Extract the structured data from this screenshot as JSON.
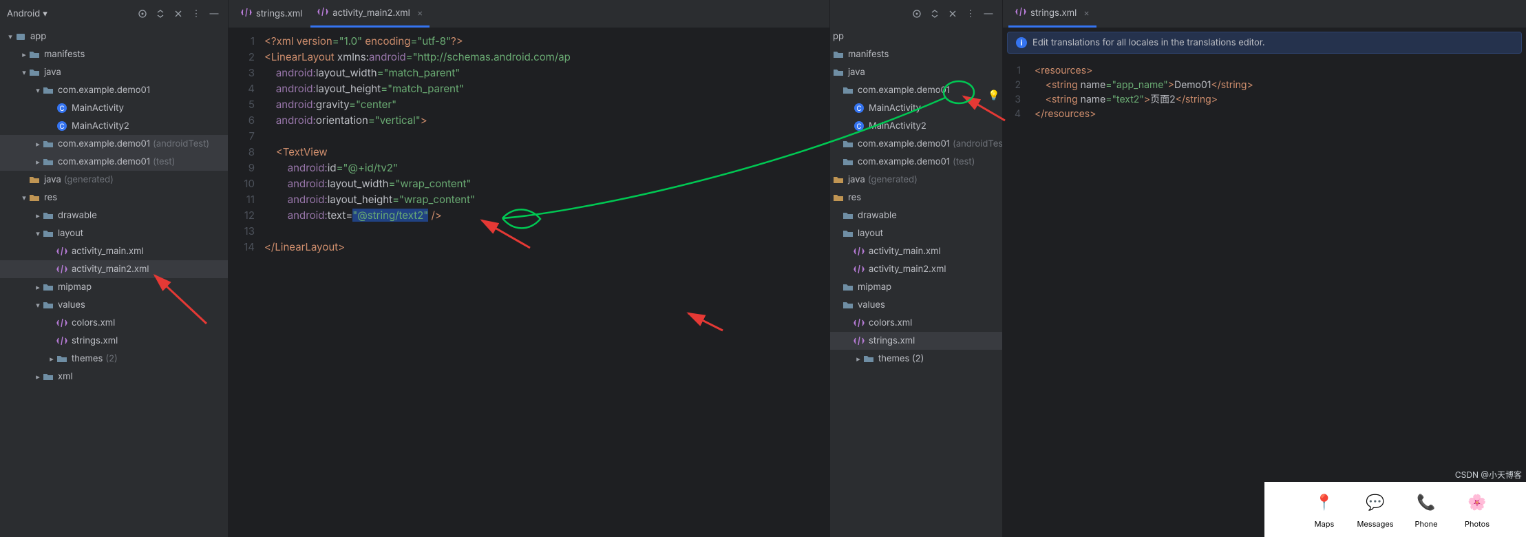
{
  "leftHeader": {
    "label": "Android"
  },
  "leftTree": {
    "app": "app",
    "manifests": "manifests",
    "java": "java",
    "pkg": "com.example.demo01",
    "mainActivity": "MainActivity",
    "mainActivity2": "MainActivity2",
    "pkgTest": "com.example.demo01",
    "pkgTestSuffix": "(androidTest)",
    "pkgUnit": "com.example.demo01",
    "pkgUnitSuffix": "(test)",
    "javaGen": "java",
    "javaGenSuffix": "(generated)",
    "res": "res",
    "drawable": "drawable",
    "layout": "layout",
    "layoutMain": "activity_main.xml",
    "layoutMain2": "activity_main2.xml",
    "mipmap": "mipmap",
    "values": "values",
    "colors": "colors.xml",
    "strings": "strings.xml",
    "themes": "themes",
    "themesSuffix": "(2)",
    "xmlFolder": "xml"
  },
  "midTabs": {
    "tab1": "strings.xml",
    "tab2": "activity_main2.xml"
  },
  "code1": {
    "l1a": "<?",
    "l1b": "xml version",
    "l1c": "=\"1.0\"",
    "l1d": " encoding",
    "l1e": "=\"utf-8\"",
    "l1f": "?>",
    "l2a": "<LinearLayout ",
    "l2b": "xmlns:",
    "l2c": "android",
    "l2d": "=\"http://schemas.android.com/ap",
    "l3a": "    ",
    "l3ns": "android:",
    "l3b": "layout_width",
    "l3c": "=\"match_parent\"",
    "l4a": "    ",
    "l4ns": "android:",
    "l4b": "layout_height",
    "l4c": "=\"match_parent\"",
    "l5a": "    ",
    "l5ns": "android:",
    "l5b": "gravity",
    "l5c": "=\"center\"",
    "l6a": "    ",
    "l6ns": "android:",
    "l6b": "orientation",
    "l6c": "=\"vertical\"",
    "l6d": ">",
    "l8a": "    <TextView",
    "l9a": "        ",
    "l9ns": "android:",
    "l9b": "id",
    "l9c": "=\"@+id/tv2\"",
    "l10a": "        ",
    "l10ns": "android:",
    "l10b": "layout_width",
    "l10c": "=\"wrap_content\"",
    "l11a": "        ",
    "l11ns": "android:",
    "l11b": "layout_height",
    "l11c": "=\"wrap_content\"",
    "l12a": "        ",
    "l12ns": "android:",
    "l12b": "text",
    "l12c": "=",
    "l12d": "\"@string/text2\"",
    "l12e": " />",
    "l14a": "</LinearLayout>"
  },
  "gutter1": [
    "1",
    "2",
    "3",
    "4",
    "5",
    "6",
    "7",
    "8",
    "9",
    "10",
    "11",
    "12",
    "13",
    "14"
  ],
  "miniTree": {
    "pp": "pp",
    "manifests": "manifests",
    "java": "java",
    "pkg": "com.example.demo01",
    "mainActivity": "MainActivity",
    "mainActivity2": "MainActivity2",
    "pkgTest": "com.example.demo01",
    "pkgTestSuffix": "(androidTest)",
    "pkgUnit": "com.example.demo01",
    "pkgUnitSuffix": "(test)",
    "javaGen": "java",
    "javaGenSuffix": "(generated)",
    "res": "res",
    "drawable": "drawable",
    "layout": "layout",
    "amain": "activity_main.xml",
    "amain2": "activity_main2.xml",
    "mipmap": "mipmap",
    "values": "values",
    "colors": "colors.xml",
    "strings": "strings.xml",
    "themes": "themes (2)"
  },
  "rightTabs": {
    "tab1": "strings.xml"
  },
  "notice": "Edit translations for all locales in the translations editor.",
  "gutter2": [
    "1",
    "2",
    "3",
    "4"
  ],
  "code2": {
    "l1": "<resources>",
    "l2a": "    <string ",
    "l2b": "name",
    "l2c": "=\"app_name\"",
    "l2d": ">",
    "l2e": "Demo01",
    "l2f": "</string>",
    "l3a": "    <string ",
    "l3b": "name",
    "l3c": "=\"text2\"",
    "l3d": ">",
    "l3e": "页面2",
    "l3f": "</string>",
    "l4": "</resources>"
  },
  "apps": {
    "maps": "Maps",
    "messages": "Messages",
    "phone": "Phone",
    "photos": "Photos"
  },
  "watermark": "CSDN @小天博客"
}
